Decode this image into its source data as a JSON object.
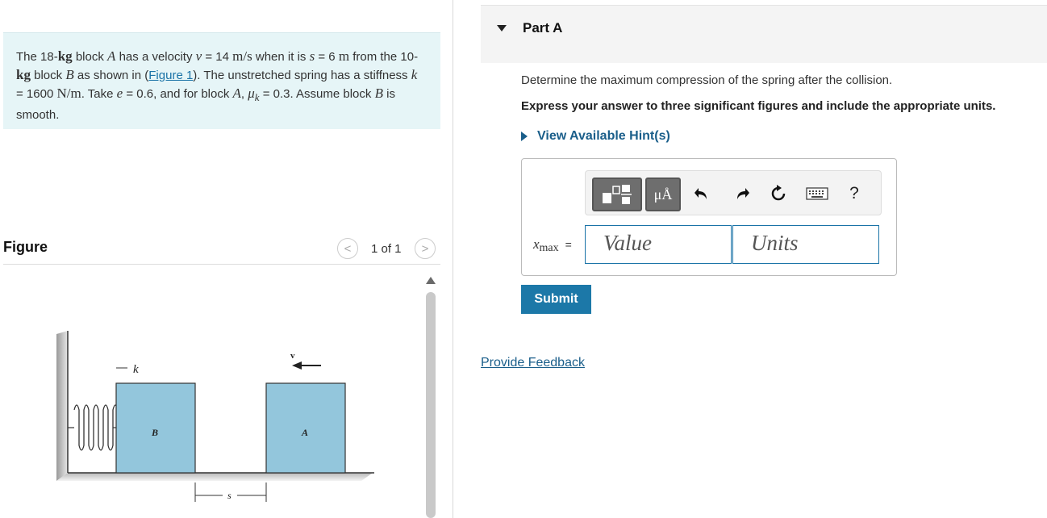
{
  "problem": {
    "t1": "The 18-",
    "u_kg": "kg",
    "t2": " block ",
    "var_A": "A",
    "t3": " has a velocity ",
    "var_v": "v",
    "t4": " = 14 ",
    "u_ms": "m/s",
    "t5": " when it is ",
    "var_s": "s",
    "t6": " = 6 ",
    "u_m": "m",
    "t7": " from the 10-",
    "t8": " block ",
    "var_B": "B",
    "t9": " as shown in (",
    "figure_link": "Figure 1",
    "t10": "). The unstretched spring has a stiffness ",
    "var_k": "k",
    "t11": " = 1600 ",
    "u_Nm": "N/m",
    "t12": ". Take ",
    "var_e": "e",
    "t13": " = 0.6, and for block ",
    "t14": ", ",
    "var_mu": "μ",
    "sub_k": "k",
    "t15": " = 0.3. Assume block ",
    "t16": " is smooth."
  },
  "figure": {
    "title": "Figure",
    "pager": "1 of 1",
    "prev_glyph": "<",
    "next_glyph": ">",
    "label_k": "k",
    "label_B": "B",
    "label_A": "A",
    "label_v": "v",
    "label_s": "s"
  },
  "part": {
    "title": "Part A",
    "question": "Determine the maximum compression of the spring after the collision.",
    "instruction": "Express your answer to three significant figures and include the appropriate units.",
    "hint": "View Available Hint(s)"
  },
  "answer": {
    "var_x": "x",
    "var_sub": "max",
    "equals": "=",
    "value_placeholder": "Value",
    "units_placeholder": "Units",
    "mu_a_label": "μÅ",
    "help_glyph": "?"
  },
  "buttons": {
    "submit": "Submit",
    "feedback": "Provide Feedback"
  },
  "icons": {
    "templates": "templates-icon",
    "units": "units-icon",
    "undo": "undo-icon",
    "redo": "redo-icon",
    "reset": "reset-icon",
    "keyboard": "keyboard-icon",
    "help": "help-icon"
  },
  "colors": {
    "accent": "#1c78a8",
    "link": "#1a5e8a",
    "problem_bg": "#e6f5f7",
    "block_fill": "#93c6dc"
  }
}
